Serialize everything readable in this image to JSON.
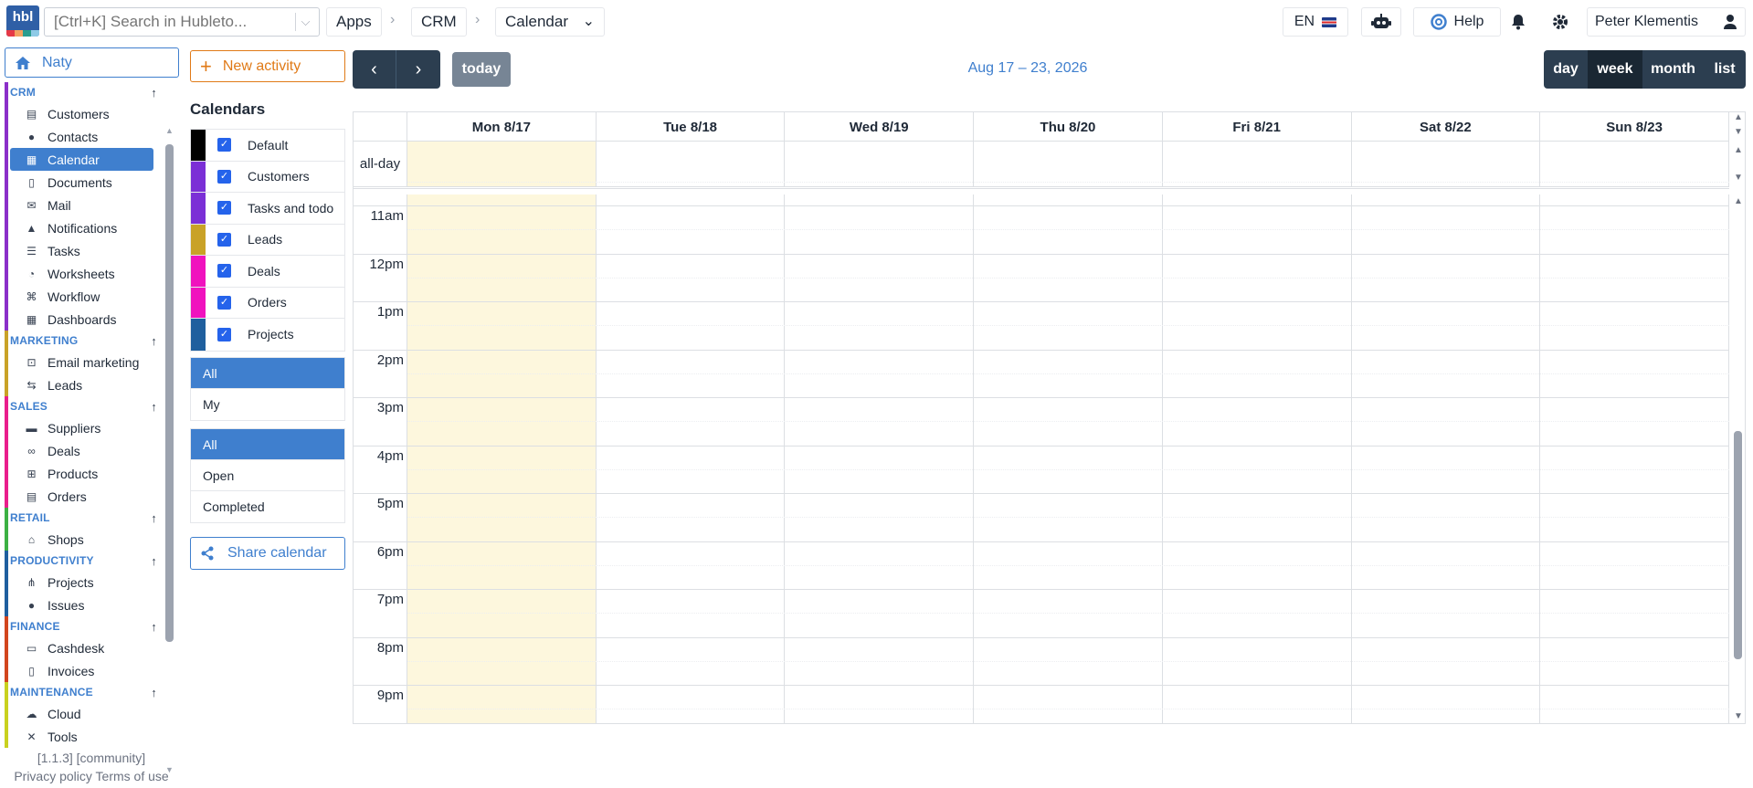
{
  "topbar": {
    "logo_text": "hbl",
    "search_placeholder": "[Ctrl+K] Search in Hubleto...",
    "breadcrumbs": [
      "Apps",
      "CRM",
      "Calendar"
    ],
    "language": "EN",
    "help_label": "Help",
    "user_name": "Peter Klementis"
  },
  "sidebar": {
    "user_pill": "Naty",
    "sections": [
      {
        "title": "CRM",
        "color": "#8b2fc9",
        "items": [
          {
            "label": "Customers",
            "icon": "id-card-icon",
            "glyph": "▤"
          },
          {
            "label": "Contacts",
            "icon": "person-icon",
            "glyph": "●"
          },
          {
            "label": "Calendar",
            "icon": "calendar-icon",
            "glyph": "▦",
            "active": true
          },
          {
            "label": "Documents",
            "icon": "document-icon",
            "glyph": "▯"
          },
          {
            "label": "Mail",
            "icon": "mail-icon",
            "glyph": "✉"
          },
          {
            "label": "Notifications",
            "icon": "bell-icon",
            "glyph": "▲"
          },
          {
            "label": "Tasks",
            "icon": "task-list-icon",
            "glyph": "☰"
          },
          {
            "label": "Worksheets",
            "icon": "user-clock-icon",
            "glyph": "◔"
          },
          {
            "label": "Workflow",
            "icon": "workflow-icon",
            "glyph": "⌘"
          },
          {
            "label": "Dashboards",
            "icon": "table-icon",
            "glyph": "▦"
          }
        ]
      },
      {
        "title": "MARKETING",
        "color": "#c9a227",
        "items": [
          {
            "label": "Email marketing",
            "icon": "email-marketing-icon",
            "glyph": "⊡"
          },
          {
            "label": "Leads",
            "icon": "people-arrows-icon",
            "glyph": "⇆"
          }
        ]
      },
      {
        "title": "SALES",
        "color": "#e91e8c",
        "items": [
          {
            "label": "Suppliers",
            "icon": "truck-icon",
            "glyph": "▬"
          },
          {
            "label": "Deals",
            "icon": "handshake-icon",
            "glyph": "∞"
          },
          {
            "label": "Products",
            "icon": "cart-icon",
            "glyph": "⊞"
          },
          {
            "label": "Orders",
            "icon": "order-card-icon",
            "glyph": "▤"
          }
        ]
      },
      {
        "title": "RETAIL",
        "color": "#3cb043",
        "items": [
          {
            "label": "Shops",
            "icon": "shop-icon",
            "glyph": "⌂"
          }
        ]
      },
      {
        "title": "PRODUCTIVITY",
        "color": "#1f5f9e",
        "items": [
          {
            "label": "Projects",
            "icon": "project-diagram-icon",
            "glyph": "⋔"
          },
          {
            "label": "Issues",
            "icon": "comment-icon",
            "glyph": "●"
          }
        ]
      },
      {
        "title": "FINANCE",
        "color": "#d2451e",
        "items": [
          {
            "label": "Cashdesk",
            "icon": "cash-register-icon",
            "glyph": "▭"
          },
          {
            "label": "Invoices",
            "icon": "invoice-icon",
            "glyph": "▯"
          }
        ]
      },
      {
        "title": "MAINTENANCE",
        "color": "#c9d11f",
        "items": [
          {
            "label": "Cloud",
            "icon": "cloud-icon",
            "glyph": "☁"
          },
          {
            "label": "Tools",
            "icon": "tools-icon",
            "glyph": "✕"
          }
        ]
      }
    ],
    "version": "[1.1.3] [community]",
    "privacy_policy": "Privacy policy",
    "terms_of_use": "Terms of use"
  },
  "calendar_panel": {
    "new_activity": "New activity",
    "title": "Calendars",
    "calendars": [
      {
        "label": "Default",
        "color": "#000000",
        "checked": true
      },
      {
        "label": "Customers",
        "color": "#7b2fd6",
        "checked": true
      },
      {
        "label": "Tasks and todo",
        "color": "#7b2fd6",
        "checked": true
      },
      {
        "label": "Leads",
        "color": "#c9a227",
        "checked": true
      },
      {
        "label": "Deals",
        "color": "#f012be",
        "checked": true
      },
      {
        "label": "Orders",
        "color": "#f012be",
        "checked": true
      },
      {
        "label": "Projects",
        "color": "#1f5f9e",
        "checked": true
      }
    ],
    "owner_filter": [
      {
        "label": "All",
        "active": true
      },
      {
        "label": "My",
        "active": false
      }
    ],
    "status_filter": [
      {
        "label": "All",
        "active": true
      },
      {
        "label": "Open",
        "active": false
      },
      {
        "label": "Completed",
        "active": false
      }
    ],
    "share_label": "Share calendar"
  },
  "toolbar": {
    "today_label": "today",
    "date_range": "Aug 17 – 23, 2026",
    "views": [
      {
        "label": "day",
        "active": false
      },
      {
        "label": "week",
        "active": true
      },
      {
        "label": "month",
        "active": false
      },
      {
        "label": "list",
        "active": false
      }
    ]
  },
  "grid": {
    "all_day_label": "all-day",
    "days": [
      {
        "label": "Mon 8/17",
        "today": true
      },
      {
        "label": "Tue 8/18",
        "today": false
      },
      {
        "label": "Wed 8/19",
        "today": false
      },
      {
        "label": "Thu 8/20",
        "today": false
      },
      {
        "label": "Fri 8/21",
        "today": false
      },
      {
        "label": "Sat 8/22",
        "today": false
      },
      {
        "label": "Sun 8/23",
        "today": false
      }
    ],
    "hours": [
      "11am",
      "12pm",
      "1pm",
      "2pm",
      "3pm",
      "4pm",
      "5pm",
      "6pm",
      "7pm",
      "8pm",
      "9pm"
    ]
  }
}
